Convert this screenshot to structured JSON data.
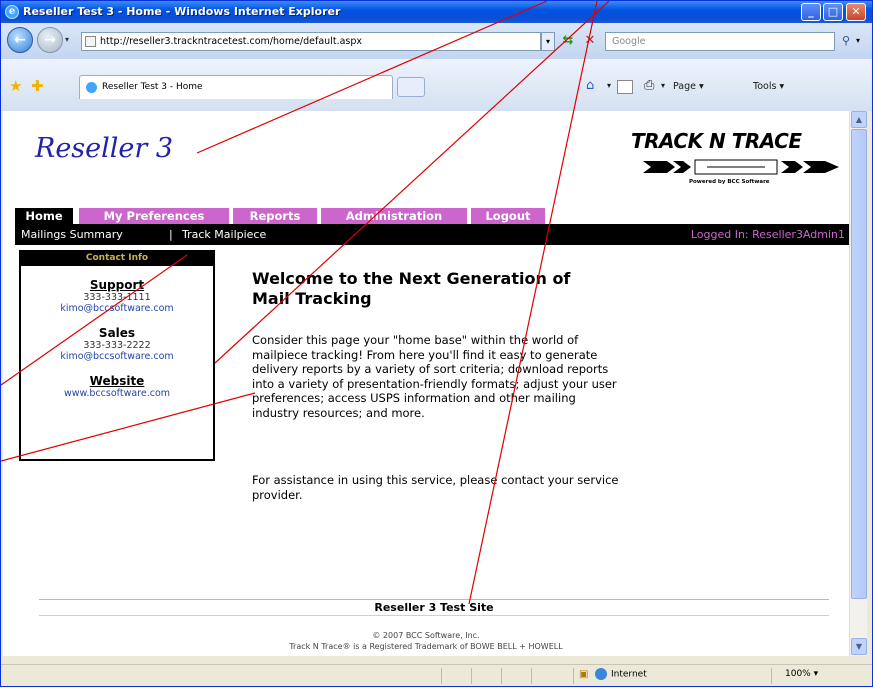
{
  "window": {
    "title": "Reseller Test 3 - Home - Windows Internet Explorer",
    "min_glyph": "_",
    "max_glyph": "□",
    "close_glyph": "✕"
  },
  "address_bar": {
    "url": "http://reseller3.trackntracetest.com/home/default.aspx",
    "search_placeholder": "Google"
  },
  "tab": {
    "title": "Reseller Test 3 - Home"
  },
  "command_bar": {
    "page_label": "Page ▾",
    "tools_label": "Tools ▾"
  },
  "page": {
    "site_title": "Reseller 3",
    "logo": {
      "title": "TRACK N TRACE",
      "tagline": "Powered by BCC Software"
    },
    "nav_tabs": [
      "Home",
      "My Preferences",
      "Reports",
      "Administration",
      "Logout"
    ],
    "subnav": {
      "item1": "Mailings Summary",
      "separator": "|",
      "item2": "Track Mailpiece",
      "logged_in": "Logged In: Reseller3Admin1"
    },
    "contact": {
      "header": "Contact Info",
      "support_heading": "Support",
      "support_phone": "333-333-1111",
      "support_email": "kimo@bccsoftware.com",
      "sales_heading": "Sales",
      "sales_phone": "333-333-2222",
      "sales_email": "kimo@bccsoftware.com",
      "website_heading": "Website",
      "website_url": "www.bccsoftware.com"
    },
    "welcome_heading": "Welcome to the Next Generation of Mail Tracking",
    "paragraph1": "Consider this page your \"home base\" within the world of mailpiece tracking! From here you'll find it easy to generate delivery reports by a variety of sort criteria; download reports into a variety of presentation-friendly formats; adjust your user preferences; access USPS information and other mailing industry resources; and more.",
    "paragraph2": "For assistance in using this service, please contact your service provider.",
    "footer_site": "Reseller 3 Test Site",
    "copyright": "© 2007 BCC Software, Inc.",
    "trademark": "Track N Trace® is a Registered Trademark of BOWE BELL + HOWELL"
  },
  "status_bar": {
    "zone": "Internet",
    "zoom": "100% ▾"
  },
  "colors": {
    "title_bar": "#0054e3",
    "brand_blue": "#2222aa",
    "tab_magenta": "#cc66cc",
    "contact_header_gold": "#c8b34a",
    "annotation_red": "#e00000"
  }
}
